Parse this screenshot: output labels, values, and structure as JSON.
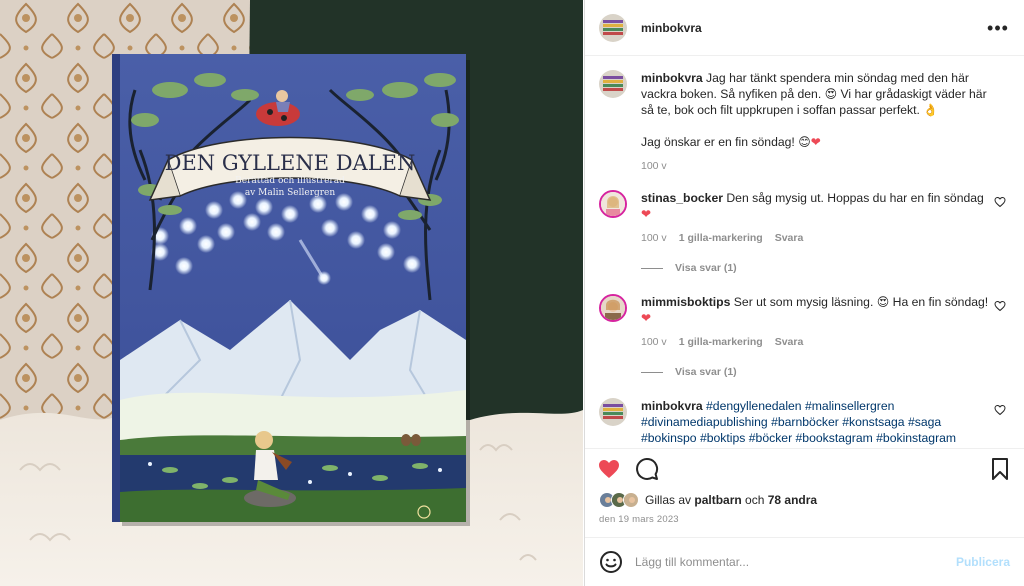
{
  "post": {
    "username": "minbokvra",
    "more_icon": "more-icon",
    "caption_line1": "Jag har tänkt spendera min söndag med den här vackra boken. Så nyfiken på den.",
    "caption_line2": "Vi har grådaskigt väder här så te, bok och filt uppkrupen i soffan passar perfekt.",
    "caption_line3": "Jag önskar er en fin söndag!",
    "caption_age": "100 v",
    "likes_prefix": "Gillas av",
    "likes_user": "paltbarn",
    "likes_and": "och",
    "likes_others": "78 andra",
    "date": "den 19 mars 2023"
  },
  "book": {
    "title": "DEN GYLLENE DALEN",
    "subtitle_line1": "Berättad och illustrerad",
    "subtitle_line2": "av Malin Sellergren"
  },
  "comments": [
    {
      "username": "stinas_bocker",
      "text": "Den såg mysig ut. Hoppas du har en fin söndag",
      "age": "100 v",
      "likes": "1 gilla-markering",
      "reply": "Svara",
      "view_replies": "Visa svar (1)"
    },
    {
      "username": "mimmisboktips",
      "text_a": "Ser ut som mysig läsning.",
      "text_b": "Ha en fin söndag!",
      "age": "100 v",
      "likes": "1 gilla-markering",
      "reply": "Svara",
      "view_replies": "Visa svar (1)"
    },
    {
      "username": "minbokvra",
      "hashtags": [
        "#dengyllenedalen",
        "#malinsellergren",
        "#divinamediapublishing",
        "#barnböcker",
        "#konstsaga",
        "#saga",
        "#bokinspo",
        "#boktips",
        "#böcker",
        "#bookstagram",
        "#bokinstagram"
      ]
    }
  ],
  "add_comment": {
    "placeholder": "Lägg till kommentar...",
    "post_label": "Publicera"
  },
  "colors": {
    "like_red": "#ed4956",
    "link_blue": "#00376b",
    "publish_disabled": "#b2dffc",
    "cover_blue": "#4a5fa8"
  }
}
